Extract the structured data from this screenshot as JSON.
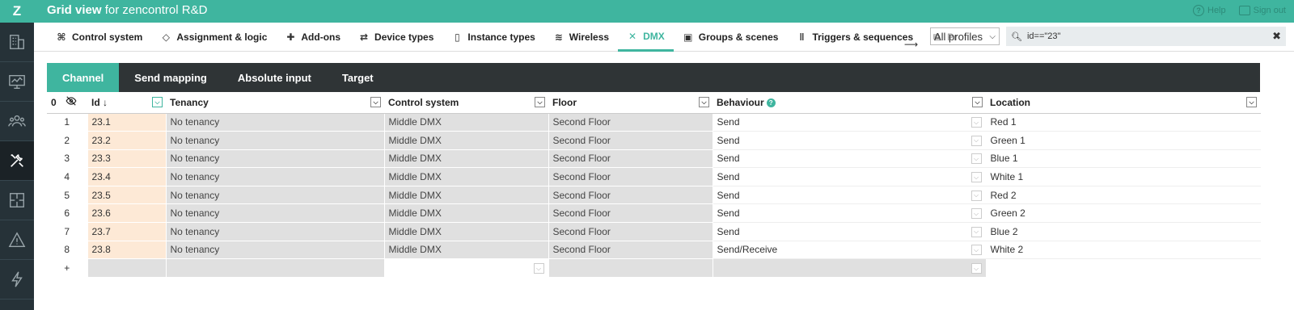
{
  "app": {
    "logo": "Z",
    "title_bold": "Grid view",
    "title_rest": " for zencontrol R&D",
    "help_label": "Help",
    "signout_label": "Sign out"
  },
  "sidebar": {
    "items": [
      {
        "name": "building-icon"
      },
      {
        "name": "monitor-icon"
      },
      {
        "name": "users-icon"
      },
      {
        "name": "tools-icon",
        "active": true
      },
      {
        "name": "floorplan-icon"
      },
      {
        "name": "warning-icon"
      },
      {
        "name": "lightning-icon"
      }
    ]
  },
  "nav": {
    "tabs": [
      {
        "label": "Control system",
        "icon": "⌘"
      },
      {
        "label": "Assignment & logic",
        "icon": "◇"
      },
      {
        "label": "Add-ons",
        "icon": "✚"
      },
      {
        "label": "Device types",
        "icon": "⇄"
      },
      {
        "label": "Instance types",
        "icon": "▯"
      },
      {
        "label": "Wireless",
        "icon": "≋"
      },
      {
        "label": "DMX",
        "icon": "✕",
        "active": true
      },
      {
        "label": "Groups & scenes",
        "icon": "▣"
      },
      {
        "label": "Triggers & sequences",
        "icon": "‖"
      },
      {
        "label": "Pr",
        "icon": "⧉",
        "faded": true
      }
    ],
    "profile_select": "All profiles",
    "search_value": "id==\"23\""
  },
  "subtabs": [
    "Channel",
    "Send mapping",
    "Absolute input",
    "Target"
  ],
  "table": {
    "count": "0",
    "headers": {
      "id": "Id ↓",
      "tenancy": "Tenancy",
      "control_system": "Control system",
      "floor": "Floor",
      "behaviour": "Behaviour",
      "location": "Location"
    },
    "rows": [
      {
        "n": "1",
        "id": "23.1",
        "tenancy": "No tenancy",
        "cs": "Middle DMX",
        "floor": "Second Floor",
        "behaviour": "Send",
        "location": "Red 1"
      },
      {
        "n": "2",
        "id": "23.2",
        "tenancy": "No tenancy",
        "cs": "Middle DMX",
        "floor": "Second Floor",
        "behaviour": "Send",
        "location": "Green 1"
      },
      {
        "n": "3",
        "id": "23.3",
        "tenancy": "No tenancy",
        "cs": "Middle DMX",
        "floor": "Second Floor",
        "behaviour": "Send",
        "location": "Blue 1"
      },
      {
        "n": "4",
        "id": "23.4",
        "tenancy": "No tenancy",
        "cs": "Middle DMX",
        "floor": "Second Floor",
        "behaviour": "Send",
        "location": "White 1"
      },
      {
        "n": "5",
        "id": "23.5",
        "tenancy": "No tenancy",
        "cs": "Middle DMX",
        "floor": "Second Floor",
        "behaviour": "Send",
        "location": "Red 2"
      },
      {
        "n": "6",
        "id": "23.6",
        "tenancy": "No tenancy",
        "cs": "Middle DMX",
        "floor": "Second Floor",
        "behaviour": "Send",
        "location": "Green 2"
      },
      {
        "n": "7",
        "id": "23.7",
        "tenancy": "No tenancy",
        "cs": "Middle DMX",
        "floor": "Second Floor",
        "behaviour": "Send",
        "location": "Blue 2"
      },
      {
        "n": "8",
        "id": "23.8",
        "tenancy": "No tenancy",
        "cs": "Middle DMX",
        "floor": "Second Floor",
        "behaviour": "Send/Receive",
        "location": "White 2"
      }
    ],
    "add_row_label": "+"
  },
  "colors": {
    "accent": "#3fb59f",
    "sidebar": "#263238",
    "subtab_bar": "#2f3436",
    "id_cell": "#fde9d6"
  }
}
